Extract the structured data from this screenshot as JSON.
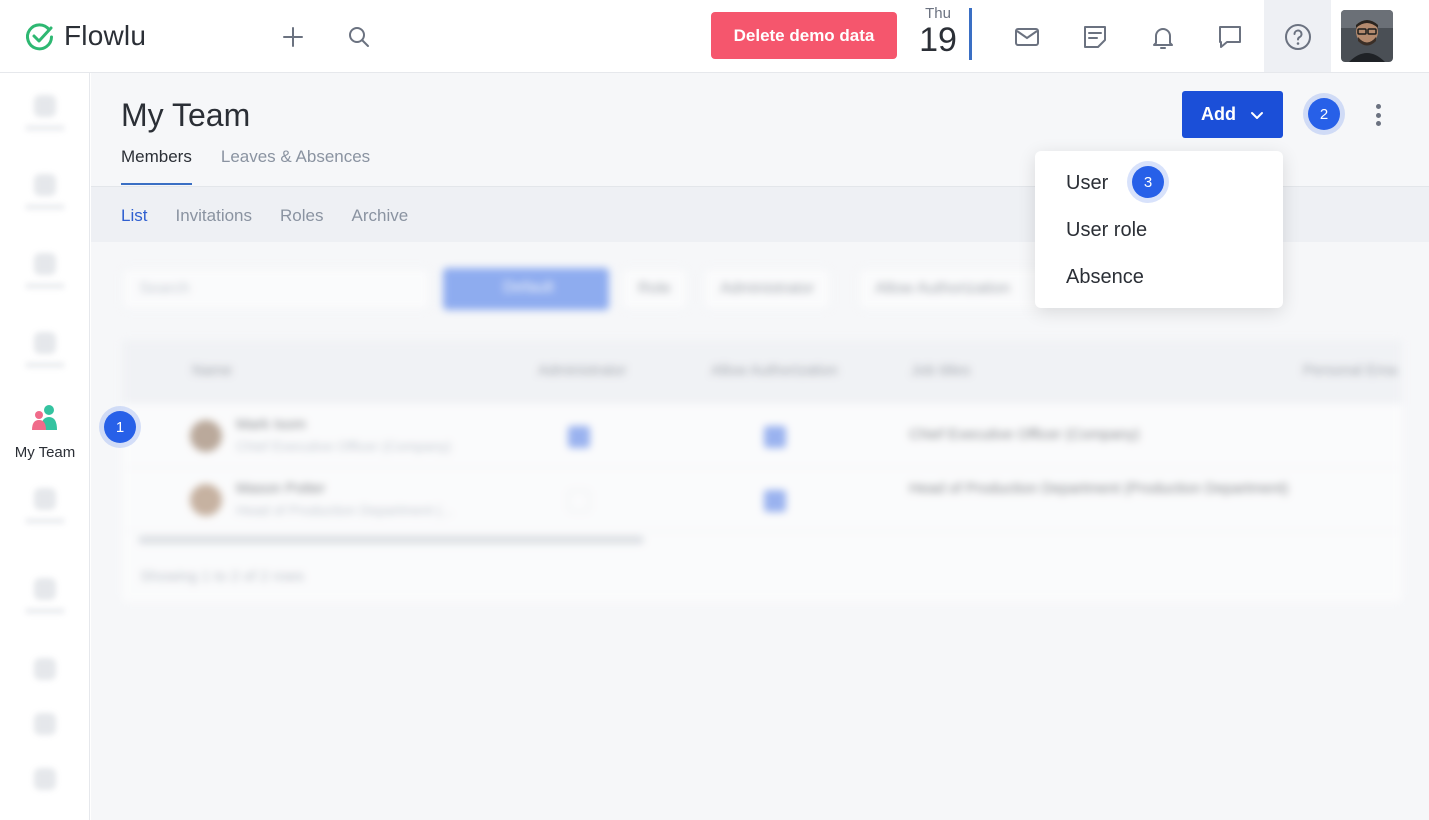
{
  "app": {
    "logo_text": "Flowlu"
  },
  "topbar": {
    "delete_demo_label": "Delete demo data",
    "date": {
      "day_of_week": "Thu",
      "day": "19"
    },
    "icons": [
      "plus-icon",
      "search-icon",
      "mail-icon",
      "notes-icon",
      "bell-icon",
      "chat-icon",
      "help-icon"
    ]
  },
  "sidebar": {
    "active_item": {
      "label": "My Team",
      "icon": "team-icon"
    }
  },
  "page": {
    "title": "My Team",
    "tabs": [
      {
        "label": "Members",
        "active": true
      },
      {
        "label": "Leaves & Absences",
        "active": false
      }
    ],
    "subnav": [
      {
        "label": "List",
        "active": true
      },
      {
        "label": "Invitations",
        "active": false
      },
      {
        "label": "Roles",
        "active": false
      },
      {
        "label": "Archive",
        "active": false
      }
    ],
    "add_button_label": "Add"
  },
  "add_menu": {
    "items": [
      {
        "label": "User"
      },
      {
        "label": "User role"
      },
      {
        "label": "Absence"
      }
    ]
  },
  "markers": {
    "m1": "1",
    "m2": "2",
    "m3": "3"
  },
  "background_content": {
    "search_placeholder": "Search",
    "filter_label": "Default",
    "chips": [
      "Role",
      "Administrator",
      "Allow Authorization"
    ],
    "columns": [
      "Name",
      "Administrator",
      "Allow Authorization",
      "Job titles",
      "Personal Ema"
    ],
    "rows": [
      {
        "name": "Mark Isom",
        "subtitle": "Chief Executive Officer (Company)",
        "administrator": true,
        "allow_authorization": true,
        "job_title": "Chief Executive Officer (Company)"
      },
      {
        "name": "Mason Potter",
        "subtitle": "Head of Production Department (...",
        "administrator": false,
        "allow_authorization": true,
        "job_title": "Head of Production Department (Production Department)"
      }
    ],
    "footer": "Showing 1 to 2 of 2 rows"
  },
  "colors": {
    "accent": "#1b4fd8",
    "marker": "#2760e8",
    "delete_button": "#f5566d",
    "logo_check": "#2eb872"
  }
}
